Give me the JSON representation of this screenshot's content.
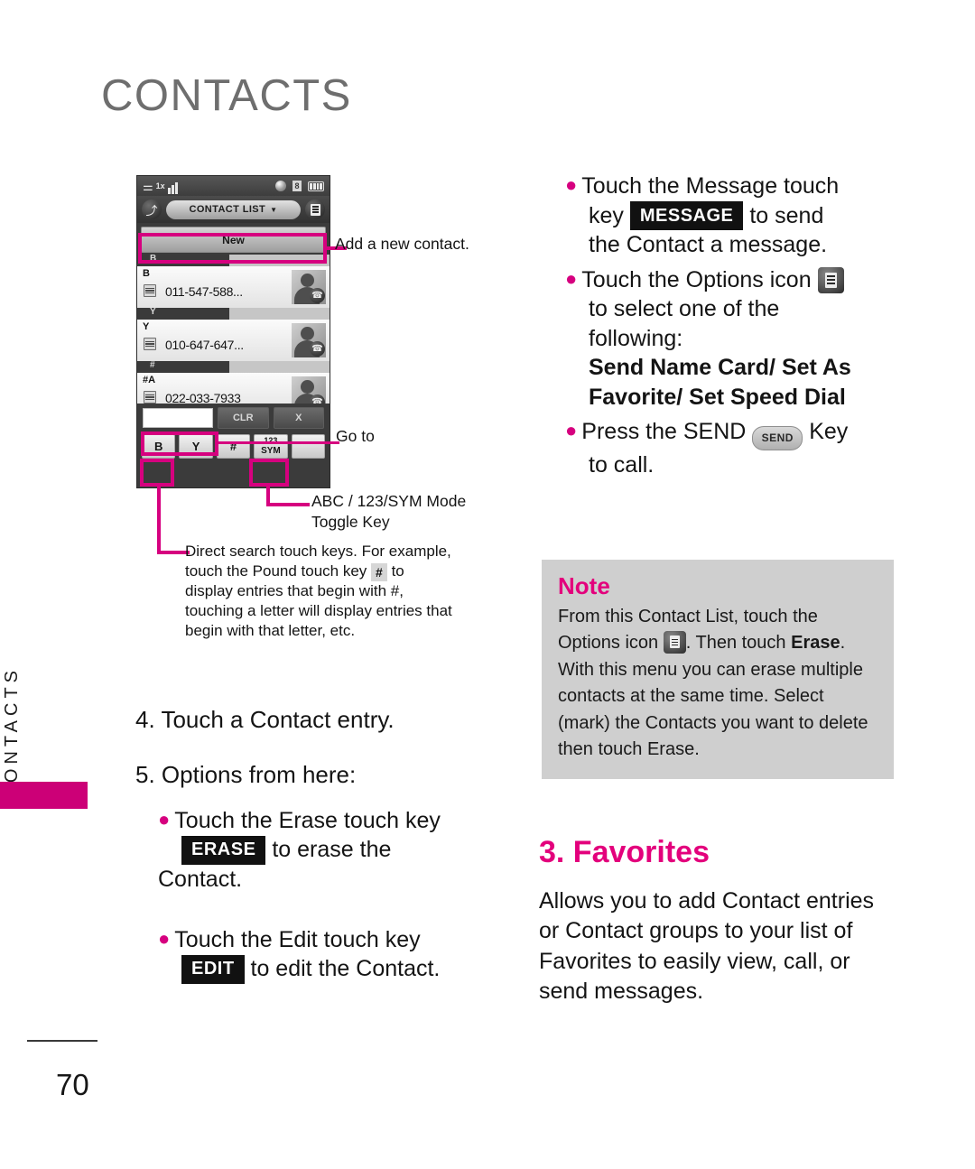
{
  "page": {
    "title": "CONTACTS",
    "side_tab_label": "CONTACTS",
    "number": "70"
  },
  "phone": {
    "status_bar": {
      "signal_icon": "signal-antenna-icon",
      "network_label": "1x",
      "globe_icon": "globe-icon",
      "bluetooth_label": "8",
      "battery_icon": "battery-icon"
    },
    "title_bar": {
      "back_icon": "back-arrow-icon",
      "title": "CONTACT LIST",
      "caret": "▼",
      "options_icon": "options-menu-icon"
    },
    "new_button": "New",
    "groups": [
      {
        "header": "B",
        "letter": "B",
        "number": "011-547-588..."
      },
      {
        "header": "Y",
        "letter": "Y",
        "number": "010-647-647..."
      },
      {
        "header": "#",
        "letter": "#A",
        "number": "022-033-7933"
      }
    ],
    "goto_row": {
      "input_value": "",
      "clear_label": "CLR",
      "close_label": "X"
    },
    "search_keys": [
      "B",
      "Y",
      "#"
    ],
    "mode_key": {
      "line1": "123",
      "line2": "SYM"
    }
  },
  "callouts": {
    "add_new": "Add a new contact.",
    "go_to": "Go to",
    "toggle_line1": "ABC / 123/SYM Mode",
    "toggle_line2": "Toggle Key",
    "direct_search_1": "Direct search touch keys. For example,",
    "direct_search_2a": "touch the Pound touch key",
    "direct_search_pound": "#",
    "direct_search_2b": "to",
    "direct_search_3": "display entries that begin with #,",
    "direct_search_4": "touching a letter will display entries that",
    "direct_search_5": "begin with that letter, etc."
  },
  "left_column": {
    "step4": "4. Touch a Contact entry.",
    "step5": "5. Options from here:",
    "bullet_erase": {
      "line1": "Touch the Erase touch key",
      "key": "ERASE",
      "line2_after": "to erase the",
      "line3": "Contact."
    },
    "bullet_edit": {
      "line1": "Touch the Edit touch key",
      "key": "EDIT",
      "line2_after": "to edit the Contact."
    }
  },
  "right_column": {
    "bullet_message": {
      "line1": "Touch the Message touch",
      "line2_before": "key",
      "key": "MESSAGE",
      "line2_after": "to send",
      "line3": "the Contact a message."
    },
    "bullet_options": {
      "line1": "Touch the Options icon",
      "icon": "options-menu-icon",
      "line2": "to select one of the",
      "line3": "following:",
      "bold_line1": "Send Name Card/ Set As",
      "bold_line2": "Favorite/ Set Speed Dial"
    },
    "bullet_send": {
      "line1_before": "Press the SEND",
      "key": "SEND",
      "line1_after": "Key",
      "line2": "to call."
    }
  },
  "note": {
    "title": "Note",
    "t1": "From this Contact List, touch the",
    "t2": "Options icon",
    "icon": "options-menu-icon",
    "t3": ". Then touch",
    "t4_bold": "Erase",
    "t5": ". With this menu you can erase",
    "t6": "multiple contacts at the same time.",
    "t7": "Select (mark) the Contacts you",
    "t8": "want to delete then touch Erase."
  },
  "favorites": {
    "title": "3. Favorites",
    "body": "Allows you to add Contact entries or Contact groups to your list of Favorites to easily view, call, or send messages."
  },
  "colors": {
    "accent_magenta": "#d6007f",
    "note_heading": "#e3007c",
    "note_bg": "#cfcfcf",
    "title_gray": "#6e6e6e"
  }
}
